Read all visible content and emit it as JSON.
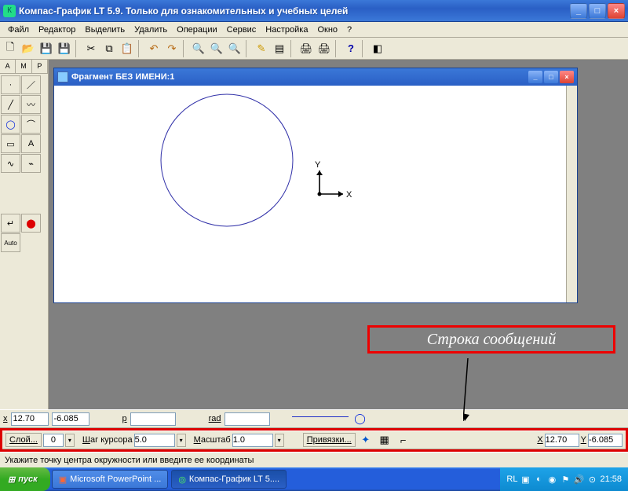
{
  "title": "Компас-График LT 5.9. Только для ознакомительных и учебных целей",
  "menu": [
    "Файл",
    "Редактор",
    "Выделить",
    "Удалить",
    "Операции",
    "Сервис",
    "Настройка",
    "Окно",
    "?"
  ],
  "doc_title": "Фрагмент БЕЗ ИМЕНИ:1",
  "callout": "Строка сообщений",
  "prop": {
    "x_lbl": "x",
    "x": "12.70",
    "y": "-6.085",
    "p_lbl": "p",
    "rad_lbl": "rad"
  },
  "ctrl": {
    "layer_lbl": "Слой...",
    "layer": "0",
    "step_lbl": "Шаг курсора",
    "step": "5.0",
    "scale_lbl": "Масштаб",
    "scale": "1.0",
    "snap_lbl": "Привязки...",
    "rx_lbl": "X",
    "rx": "12.70",
    "ry_lbl": "Y",
    "ry": "-6.085"
  },
  "status": "Укажите точку центра окружности или введите ее координаты",
  "start": "пуск",
  "task1": "Microsoft PowerPoint ...",
  "task2": "Компас-График LT 5....",
  "lang": "RL",
  "clock": "21:58"
}
